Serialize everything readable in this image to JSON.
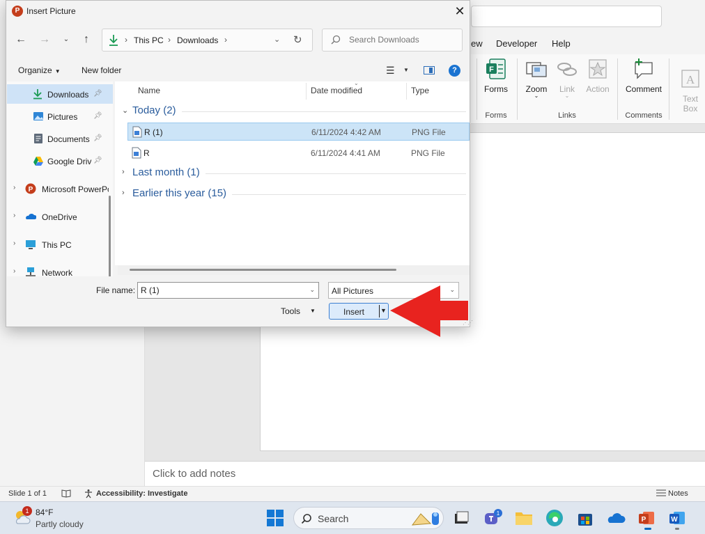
{
  "powerpoint": {
    "menu": [
      "ew",
      "Developer",
      "Help"
    ],
    "ribbon": {
      "buttons": [
        {
          "label": "Forms",
          "icon": "forms-icon",
          "enabled": true
        },
        {
          "label": "Zoom",
          "icon": "zoom-icon",
          "enabled": true
        },
        {
          "label": "Link",
          "icon": "link-icon",
          "enabled": false
        },
        {
          "label": "Action",
          "icon": "action-star-icon",
          "enabled": false
        },
        {
          "label": "Comment",
          "icon": "comment-icon",
          "enabled": true
        },
        {
          "label": "Text\nBox",
          "icon": "text-box-icon",
          "enabled": false
        }
      ],
      "groups": [
        "Forms",
        "Links",
        "Comments"
      ]
    },
    "notes_placeholder": "Click to add notes",
    "status": {
      "slide": "Slide 1 of 1",
      "accessibility": "Accessibility: Investigate",
      "notes": "Notes"
    }
  },
  "taskbar": {
    "weather": {
      "temp": "84°F",
      "condition": "Partly cloudy",
      "badge": "1",
      "icon": "weather-partly-cloudy-icon"
    },
    "search_label": "Search",
    "teams_badge": "1",
    "apps": [
      "file-explorer-icon",
      "teams-icon",
      "folder-icon",
      "edge-icon",
      "store-icon",
      "onedrive-icon",
      "powerpoint-icon",
      "word-icon"
    ]
  },
  "dialog": {
    "title": "Insert Picture",
    "address": {
      "segments": [
        "This PC",
        "Downloads"
      ]
    },
    "search_placeholder": "Search Downloads",
    "toolbar": {
      "organize": "Organize",
      "new_folder": "New folder"
    },
    "nav": [
      {
        "label": "Downloads",
        "icon": "downloads-icon",
        "pinned": true,
        "selected": true
      },
      {
        "label": "Pictures",
        "icon": "pictures-icon",
        "pinned": true
      },
      {
        "label": "Documents",
        "icon": "documents-icon",
        "pinned": true
      },
      {
        "label": "Google Drive",
        "icon": "google-drive-icon",
        "pinned": true
      },
      {
        "label": "Microsoft PowerPoint",
        "icon": "powerpoint-icon",
        "expandable": true
      },
      {
        "label": "OneDrive",
        "icon": "onedrive-icon",
        "expandable": true
      },
      {
        "label": "This PC",
        "icon": "this-pc-icon",
        "expandable": true
      },
      {
        "label": "Network",
        "icon": "network-icon",
        "expandable": true
      }
    ],
    "columns": {
      "name": "Name",
      "date": "Date modified",
      "type": "Type"
    },
    "groups": [
      {
        "label": "Today (2)",
        "expanded": true
      },
      {
        "label": "Last month (1)",
        "expanded": false
      },
      {
        "label": "Earlier this year (15)",
        "expanded": false
      }
    ],
    "files": [
      {
        "name": "R (1)",
        "date": "6/11/2024 4:42 AM",
        "type": "PNG File",
        "selected": true
      },
      {
        "name": "R",
        "date": "6/11/2024 4:41 AM",
        "type": "PNG File",
        "selected": false
      }
    ],
    "file_name_label": "File name:",
    "file_name_value": "R (1)",
    "file_type": "All Pictures",
    "tools": "Tools",
    "insert": "Insert"
  },
  "colors": {
    "accent": "#0067c0",
    "selection": "#cce4f7",
    "annotation_arrow": "#e8231f"
  }
}
